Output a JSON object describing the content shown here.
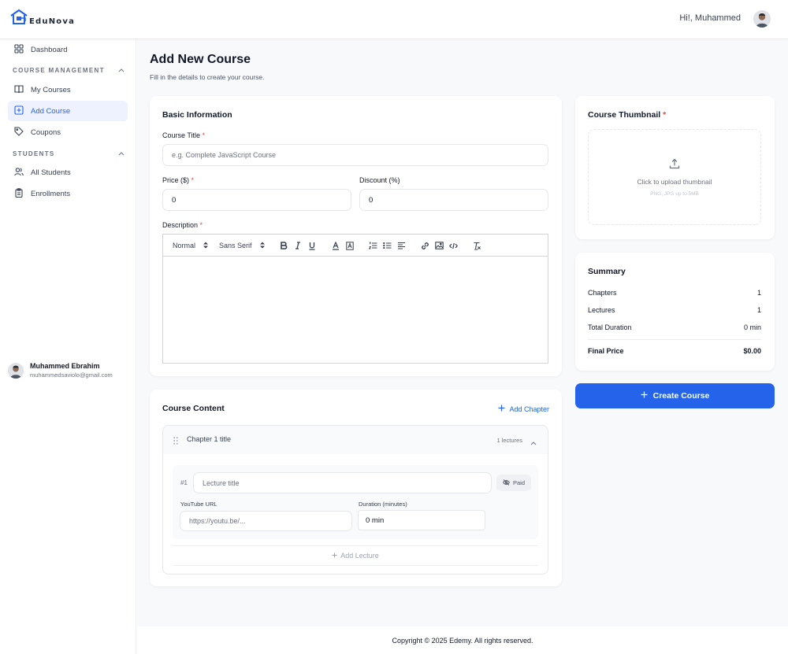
{
  "header": {
    "brand": "EduNova",
    "greeting": "Hi!, Muhammed"
  },
  "sidebar": {
    "dashboard": "Dashboard",
    "course_section": "COURSE MANAGEMENT",
    "my_courses": "My Courses",
    "add_course": "Add Course",
    "coupons": "Coupons",
    "students_section": "STUDENTS",
    "all_students": "All Students",
    "enrollments": "Enrollments",
    "user_name": "Muhammed Ebrahim",
    "user_email": "muhammedsaviolo@gmail.com"
  },
  "page": {
    "title": "Add New Course",
    "subtitle": "Fill in the details to create your course."
  },
  "basic": {
    "title": "Basic Information",
    "course_title_label": "Course Title",
    "course_title_placeholder": "e.g. Complete JavaScript Course",
    "price_label": "Price ($)",
    "price_value": "0",
    "discount_label": "Discount (%)",
    "discount_value": "0",
    "description_label": "Description",
    "toolbar_format": "Normal",
    "toolbar_font": "Sans Serif"
  },
  "content": {
    "title": "Course Content",
    "add_chapter": "Add Chapter",
    "chapter_title": "Chapter 1 title",
    "chapter_count": "1 lectures",
    "lecture_number": "#1",
    "lecture_placeholder": "Lecture title",
    "paid_label": "Paid",
    "youtube_label": "YouTube URL",
    "youtube_placeholder": "https://youtu.be/...",
    "duration_label": "Duration (minutes)",
    "duration_value": "0 min",
    "add_lecture": "Add Lecture"
  },
  "thumbnail": {
    "title": "Course Thumbnail",
    "upload_text": "Click to upload thumbnail",
    "upload_hint": "PNG, JPG up to 5MB"
  },
  "summary": {
    "title": "Summary",
    "chapters_label": "Chapters",
    "chapters_value": "1",
    "lectures_label": "Lectures",
    "lectures_value": "1",
    "duration_label": "Total Duration",
    "duration_value": "0 min",
    "final_label": "Final Price",
    "final_value": "$0.00"
  },
  "actions": {
    "create": "Create Course"
  },
  "footer": {
    "copyright": "Copyright © 2025 Edemy. All rights reserved."
  },
  "colors": {
    "accent": "#2563eb",
    "required": "#ef4444"
  }
}
